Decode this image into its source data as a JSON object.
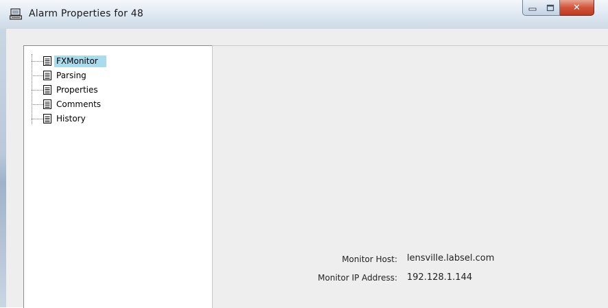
{
  "window": {
    "title": "Alarm Properties for 48",
    "icon": "computer-icon",
    "controls": {
      "minimize": "minimize-icon",
      "maximize": "maximize-icon",
      "close": "close-icon"
    }
  },
  "tree": {
    "items": [
      {
        "label": "FXMonitor",
        "icon": "document-icon",
        "selected": true
      },
      {
        "label": "Parsing",
        "icon": "document-icon",
        "selected": false
      },
      {
        "label": "Properties",
        "icon": "document-icon",
        "selected": false
      },
      {
        "label": "Comments",
        "icon": "document-icon",
        "selected": false
      },
      {
        "label": "History",
        "icon": "document-icon",
        "selected": false
      }
    ]
  },
  "details": {
    "monitor_host_label": "Monitor Host:",
    "monitor_host_value": "lensville.labsel.com",
    "monitor_ip_label": "Monitor IP Address:",
    "monitor_ip_value": "192.128.1.144"
  },
  "colors": {
    "selection": "#a9dbef",
    "close_button": "#c9452a",
    "dialog_background": "#eeeeee"
  }
}
